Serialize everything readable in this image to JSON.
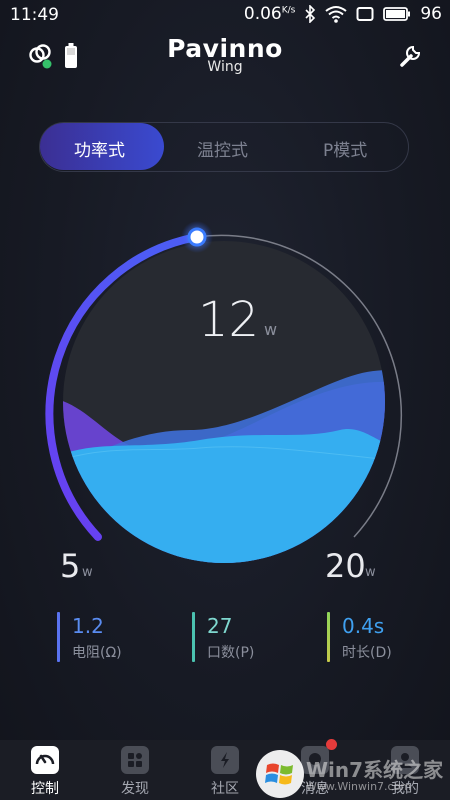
{
  "status": {
    "time": "11:49",
    "speed": "0.06",
    "speed_unit": "K/s",
    "battery": "96"
  },
  "header": {
    "brand": "Pavinno",
    "subtitle": "Wing"
  },
  "modes": [
    {
      "label": "功率式",
      "active": true
    },
    {
      "label": "温控式",
      "active": false
    },
    {
      "label": "P模式",
      "active": false
    }
  ],
  "gauge": {
    "value": "12",
    "unit": "w",
    "min": "5",
    "min_unit": "w",
    "max": "20",
    "max_unit": "w",
    "level_fraction": 0.47,
    "accent": "#5b4af0",
    "fill_color": "#35aef0"
  },
  "stats": [
    {
      "value": "1.2",
      "label": "电阻(Ω)",
      "color": "#5a73f0"
    },
    {
      "value": "27",
      "label": "口数(P)",
      "color": "#4bc2b0"
    },
    {
      "value": "0.4s",
      "label": "时长(D)",
      "color": "#8fd65a"
    }
  ],
  "tabs": [
    {
      "label": "控制",
      "icon": "control-icon",
      "active": true
    },
    {
      "label": "发现",
      "icon": "discover-icon",
      "active": false
    },
    {
      "label": "社区",
      "icon": "community-icon",
      "active": false
    },
    {
      "label": "消息",
      "icon": "message-icon",
      "active": false
    },
    {
      "label": "我的",
      "icon": "profile-icon",
      "active": false
    }
  ],
  "watermark": {
    "brand": "Win7系统之家",
    "url": "Www.Winwin7.com"
  }
}
